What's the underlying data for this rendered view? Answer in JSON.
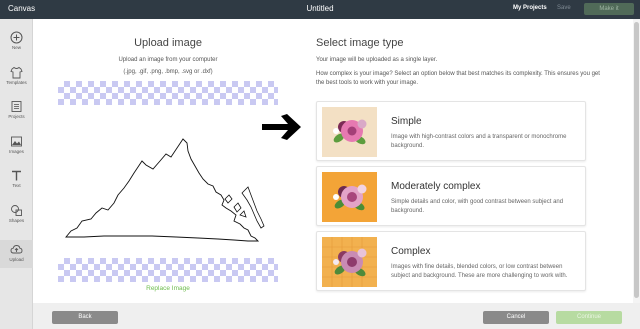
{
  "topbar": {
    "app_title": "Canvas",
    "document_title": "Untitled",
    "my_projects": "My Projects",
    "save": "Save",
    "make_it": "Make it"
  },
  "sidebar": {
    "items": [
      {
        "label": "New",
        "icon": "plus-circle-icon"
      },
      {
        "label": "Templates",
        "icon": "shirt-icon"
      },
      {
        "label": "Projects",
        "icon": "projects-icon"
      },
      {
        "label": "Images",
        "icon": "image-icon"
      },
      {
        "label": "Text",
        "icon": "text-icon"
      },
      {
        "label": "Shapes",
        "icon": "shapes-icon"
      },
      {
        "label": "Upload",
        "icon": "cloud-upload-icon"
      }
    ]
  },
  "upload": {
    "title": "Upload image",
    "description": "Upload an image from your computer",
    "formats": "(.jpg, .gif, .png, .bmp, .svg or .dxf)",
    "replace_link": "Replace Image"
  },
  "select_type": {
    "title": "Select image type",
    "line1": "Your image will be uploaded as a single layer.",
    "line2": "How complex is your image? Select an option below that best matches its complexity. This ensures you get the best tools to work with your image.",
    "options": [
      {
        "title": "Simple",
        "description": "Image with high-contrast colors and a transparent or monochrome background.",
        "thumb_bg": "#f3e0c4"
      },
      {
        "title": "Moderately complex",
        "description": "Simple details and color, with good contrast between subject and background.",
        "thumb_bg": "#f3a437"
      },
      {
        "title": "Complex",
        "description": "Images with fine details, blended colors, or low contrast between subject and background. These are more challenging to work with.",
        "thumb_bg": "#f2b14f"
      }
    ]
  },
  "footer": {
    "back": "Back",
    "cancel": "Cancel",
    "continue": "Continue"
  },
  "colors": {
    "topbar": "#2f3a44",
    "accent_green": "#6ebd4d",
    "checker": "#c9c9f2"
  }
}
